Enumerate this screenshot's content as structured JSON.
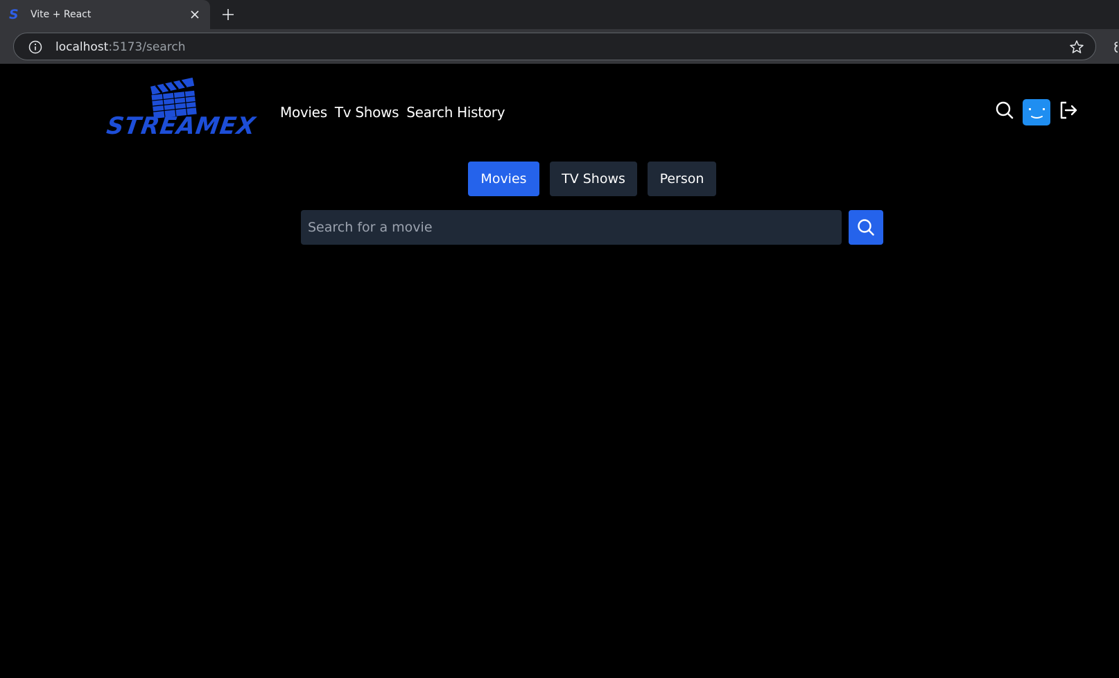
{
  "browser": {
    "tab_title": "Vite + React",
    "favicon_letter": "S",
    "url_host": "localhost",
    "url_path": ":5173/search"
  },
  "header": {
    "logo_text": "STREAMEX",
    "nav": {
      "movies": "Movies",
      "tv_shows": "Tv Shows",
      "search_history": "Search History"
    }
  },
  "search": {
    "tabs": {
      "movies": "Movies",
      "tv_shows": "TV Shows",
      "person": "Person"
    },
    "active_tab": "Movies",
    "placeholder": "Search for a movie",
    "value": ""
  },
  "colors": {
    "accent": "#2563eb",
    "logo": "#1d4ed8",
    "avatar": "#1f8ef1",
    "inactive_button": "#1f2937",
    "background": "#000000"
  },
  "icons": {
    "header_search": "search-icon",
    "avatar": "avatar-smile-icon",
    "logout": "logout-icon",
    "search_button": "search-icon"
  }
}
